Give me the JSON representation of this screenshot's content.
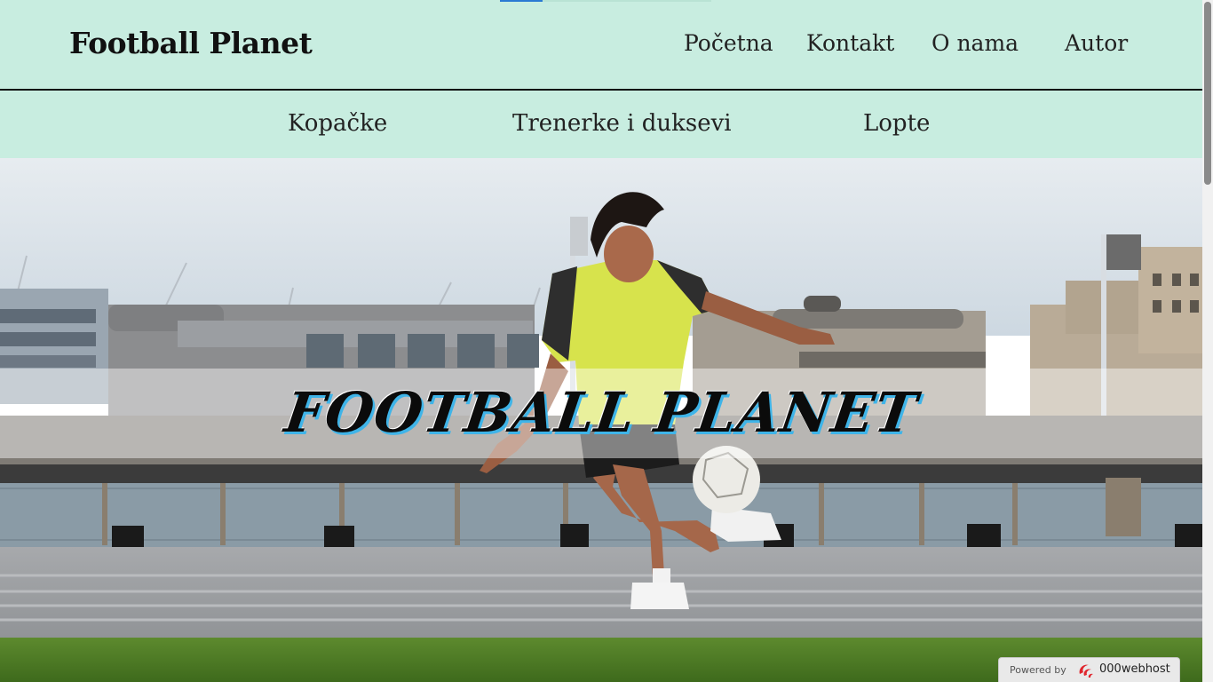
{
  "header": {
    "brand": "Football Planet",
    "nav": [
      "Početna",
      "Kontakt",
      "O nama",
      "Autor"
    ]
  },
  "subnav": [
    "Kopačke",
    "Trenerke i duksevi",
    "Lopte"
  ],
  "hero": {
    "title": "FOOTBALL PLANET"
  },
  "badge": {
    "prefix": "Powered by",
    "name": "000webhost"
  },
  "colors": {
    "nav_bg": "#c8ede0",
    "title_shadow": "#3fb4e8"
  }
}
